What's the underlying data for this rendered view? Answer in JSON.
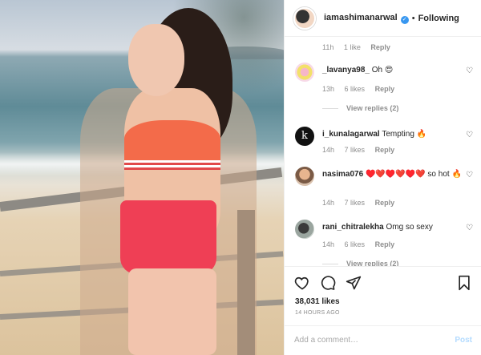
{
  "post": {
    "username": "iamashimanarwal",
    "separator": "•",
    "follow_label": "Following",
    "likes": "38,031 likes",
    "time": "14 HOURS AGO"
  },
  "top_meta": {
    "time": "11h",
    "likes": "1 like",
    "reply": "Reply"
  },
  "comments": [
    {
      "user": "_lavanya98_",
      "text": "Oh 😍",
      "time": "13h",
      "likes": "6 likes",
      "reply": "Reply",
      "view_replies": "View replies (2)"
    },
    {
      "user": "i_kunalagarwal",
      "text": "Tempting 🔥",
      "time": "14h",
      "likes": "7 likes",
      "reply": "Reply"
    },
    {
      "user": "nasima076",
      "text": "♥️❤️♥️❤️♥️❤️ so hot 🔥",
      "time": "14h",
      "likes": "7 likes",
      "reply": "Reply"
    },
    {
      "user": "rani_chitralekha",
      "text": "Omg so sexy",
      "time": "14h",
      "likes": "6 likes",
      "reply": "Reply",
      "view_replies": "View replies (2)"
    }
  ],
  "add_comment": {
    "placeholder": "Add a comment…",
    "post_label": "Post"
  },
  "icons": {
    "like": "heart-icon",
    "comment": "comment-icon",
    "share": "share-icon",
    "save": "bookmark-icon",
    "verified": "verified-badge-icon",
    "comment_like": "small-heart-icon"
  },
  "colors": {
    "verified": "#3897f0",
    "post_button": "#b3dbff",
    "muted": "#8e8e8e"
  }
}
